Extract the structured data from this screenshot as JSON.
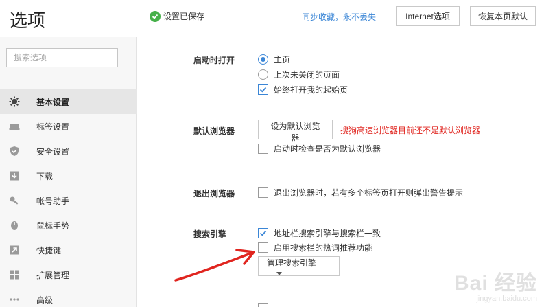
{
  "header": {
    "title": "选项",
    "saved_text": "设置已保存",
    "sync_link": "同步收藏，永不丢失",
    "internet_button": "Internet选项",
    "restore_button": "恢复本页默认"
  },
  "sidebar": {
    "search_placeholder": "搜索选项",
    "items": [
      {
        "label": "基本设置",
        "icon": "gear-icon",
        "active": true
      },
      {
        "label": "标签设置",
        "icon": "tab-icon",
        "active": false
      },
      {
        "label": "安全设置",
        "icon": "shield-check-icon",
        "active": false
      },
      {
        "label": "下载",
        "icon": "download-icon",
        "active": false
      },
      {
        "label": "帐号助手",
        "icon": "key-icon",
        "active": false
      },
      {
        "label": "鼠标手势",
        "icon": "mouse-icon",
        "active": false
      },
      {
        "label": "快捷键",
        "icon": "shortcut-arrow-icon",
        "active": false
      },
      {
        "label": "扩展管理",
        "icon": "grid-icon",
        "active": false
      },
      {
        "label": "高级",
        "icon": "more-dots-icon",
        "active": false
      }
    ]
  },
  "startup": {
    "label": "启动时打开",
    "opt_home": "主页",
    "opt_last": "上次未关闭的页面",
    "opt_always_start": "始终打开我的起始页",
    "selected": "主页",
    "always_start_checked": true
  },
  "default_browser": {
    "label": "默认浏览器",
    "button": "设为默认浏览器",
    "warning": "搜狗高速浏览器目前还不是默认浏览器",
    "check_on_start": "启动时检查是否为默认浏览器",
    "check_on_start_checked": false
  },
  "exit_browser": {
    "label": "退出浏览器",
    "warn_multi_tabs": "退出浏览器时，若有多个标签页打开则弹出警告提示",
    "checked": false
  },
  "search_engine": {
    "label": "搜索引擎",
    "sync_addressbar": "地址栏搜索引擎与搜索栏一致",
    "sync_checked": true,
    "hot_words": "启用搜索栏的热词推荐功能",
    "hot_words_checked": false,
    "manage_button": "管理搜索引擎"
  },
  "watermark": {
    "main": "Bai 经验",
    "sub": "jingyan.baidu.com"
  },
  "colors": {
    "accent": "#3b86d6",
    "saved_green": "#46b04a",
    "warning_red": "#e0251f",
    "annotation_arrow": "#e0251f"
  }
}
